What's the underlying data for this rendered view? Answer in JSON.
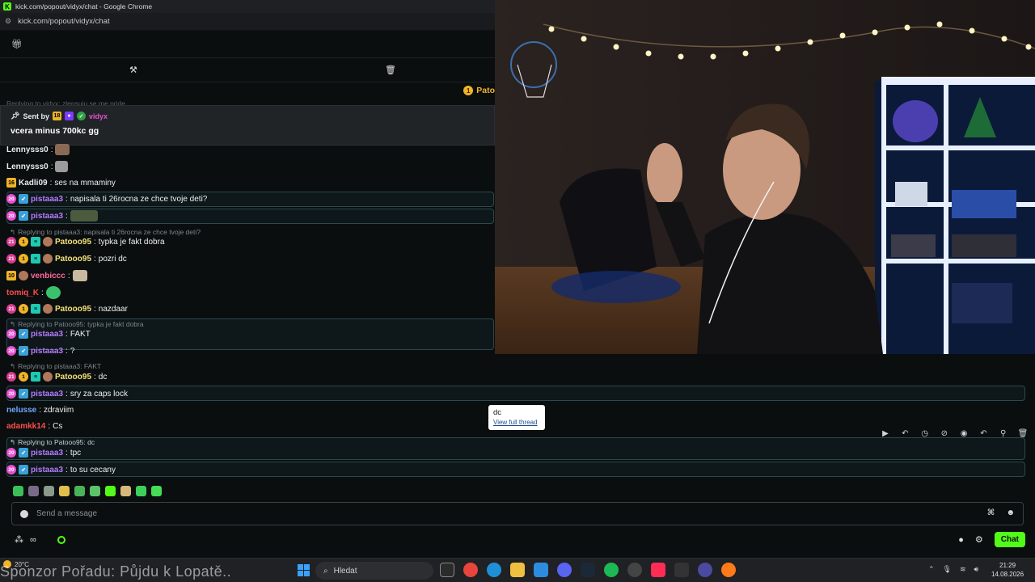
{
  "window": {
    "title": "kick.com/popout/vidyx/chat - Google Chrome",
    "url": "kick.com/popout/vidyx/chat"
  },
  "top_right": {
    "name": "Pato"
  },
  "pinned": {
    "ghost_reply": "Replying to vidyx: zlepsuju se me pride",
    "sent_by_label": "Sent by",
    "sender": "vidyx",
    "badge_18": "18",
    "text": "vcera minus 700kc gg"
  },
  "messages": [
    {
      "user": "Lennysss0",
      "text": "",
      "user_color": "#e8ebed"
    },
    {
      "user": "Lennysss0",
      "text": "",
      "user_color": "#e8ebed"
    },
    {
      "user": "Kadli09",
      "text": "ses na mmaminy",
      "user_color": "#e8ebed",
      "badge": "16"
    },
    {
      "user": "pistaaa3",
      "text": "napisala ti 26rocna ze chce tvoje deti?",
      "user_color": "#b57cff"
    },
    {
      "user": "pistaaa3",
      "text": "",
      "user_color": "#b57cff"
    },
    {
      "reply": "Replying to pistaaa3: napisala ti 26rocna ze chce tvoje deti?"
    },
    {
      "user": "Patooo95",
      "text": "typka je fakt dobra",
      "user_color": "#f3e27a"
    },
    {
      "user": "Patooo95",
      "text": "pozri dc",
      "user_color": "#f3e27a"
    },
    {
      "user": "venbiccc",
      "text": "",
      "user_color": "#ff6b9a",
      "badge": "10"
    },
    {
      "user": "tomiq_K",
      "text": "",
      "user_color": "#ff4d4d"
    },
    {
      "user": "Patooo95",
      "text": "nazdaar",
      "user_color": "#f3e27a"
    },
    {
      "reply": "Replying to Patooo95: typka je fakt dobra"
    },
    {
      "user": "pistaaa3",
      "text": "FAKT",
      "user_color": "#b57cff"
    },
    {
      "user": "pistaaa3",
      "text": "?",
      "user_color": "#b57cff"
    },
    {
      "reply": "Replying to pistaaa3: FAKT"
    },
    {
      "user": "Patooo95",
      "text": "dc",
      "user_color": "#f3e27a"
    },
    {
      "user": "pistaaa3",
      "text": "sry za caps lock",
      "user_color": "#b57cff"
    },
    {
      "user": "nelusse",
      "text": "zdraviim",
      "user_color": "#6ea8ff"
    },
    {
      "user": "adamkk14",
      "text": "Cs",
      "user_color": "#ff4d4d"
    },
    {
      "reply": "Replying to Patooo95: dc"
    },
    {
      "user": "pistaaa3",
      "text": "tpc",
      "user_color": "#b57cff"
    },
    {
      "user": "pistaaa3",
      "text": "to su cecany",
      "user_color": "#b57cff"
    }
  ],
  "tooltip": {
    "text": "dc",
    "link": "View full thread"
  },
  "input": {
    "placeholder": "Send a message"
  },
  "chat_button": "Chat",
  "taskbar": {
    "temperature": "20°C",
    "sponsor": "Sponzor Pořadu: Půjdu k Lopatě..",
    "search": "Hledat",
    "time": "21:29",
    "date": "14.08.2026"
  },
  "colors": {
    "kick_green": "#53fc18",
    "accent_purple": "#b57cff",
    "accent_gold": "#f3e27a",
    "background": "#0b0e0f"
  }
}
